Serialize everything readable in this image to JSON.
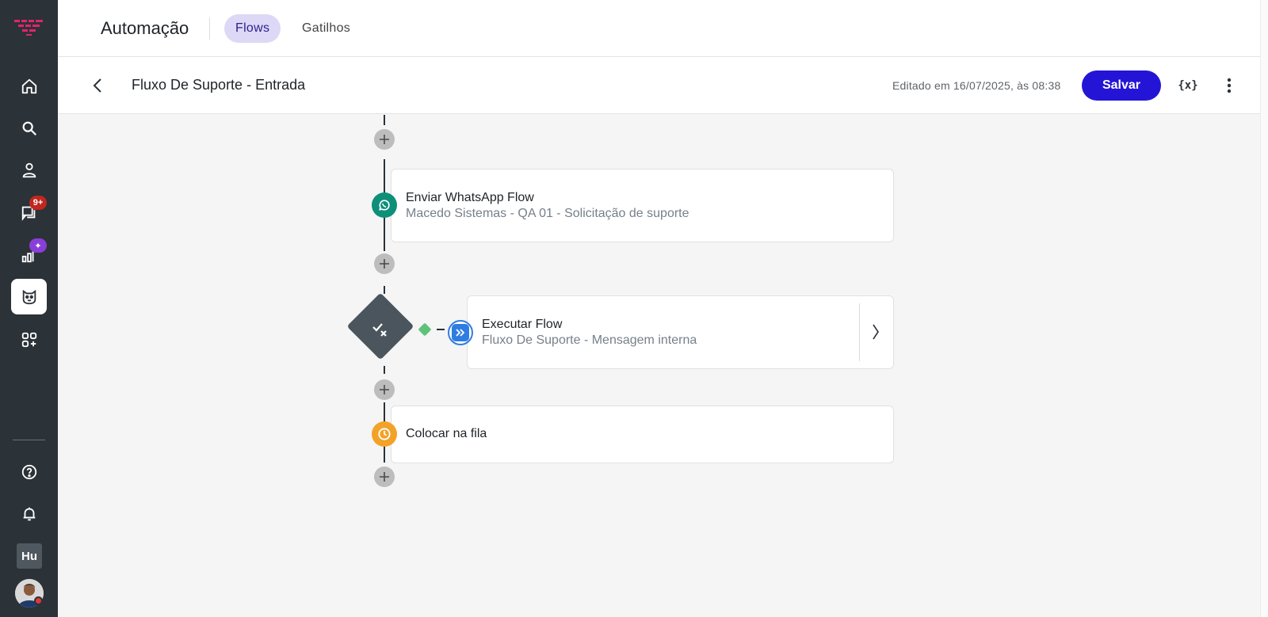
{
  "sidebar": {
    "items": [
      {
        "name": "home",
        "icon": "home-icon"
      },
      {
        "name": "search",
        "icon": "search-icon"
      },
      {
        "name": "contacts",
        "icon": "person-icon"
      },
      {
        "name": "chats",
        "icon": "chat-icon",
        "badge": "9+"
      },
      {
        "name": "reports",
        "icon": "bar-chart-icon",
        "badge": "✦"
      },
      {
        "name": "automation",
        "icon": "bot-icon",
        "active": true
      },
      {
        "name": "apps",
        "icon": "apps-add-icon"
      },
      {
        "name": "help",
        "icon": "help-icon"
      },
      {
        "name": "notifications",
        "icon": "bell-icon"
      }
    ],
    "workspace_initials": "Hu",
    "brand_color": "#e0246e"
  },
  "topnav": {
    "title": "Automação",
    "tabs": [
      {
        "label": "Flows",
        "active": true
      },
      {
        "label": "Gatilhos",
        "active": false
      }
    ]
  },
  "header": {
    "flow_name": "Fluxo De Suporte - Entrada",
    "edited_text": "Editado em 16/07/2025, às 08:38",
    "save_label": "Salvar",
    "vars_label": "{x}",
    "accent_color": "#2415d6"
  },
  "canvas": {
    "nodes": [
      {
        "type": "whatsapp",
        "title": "Enviar WhatsApp Flow",
        "subtitle": "Macedo Sistemas - QA 01 - Solicitação de suporte",
        "icon": "whatsapp-icon",
        "color": "#0e8f7a"
      },
      {
        "type": "condition",
        "icon": "check-x-icon"
      },
      {
        "type": "execute-flow",
        "title": "Executar Flow",
        "subtitle": "Fluxo De Suporte - Mensagem interna",
        "icon": "double-chevron-icon",
        "color": "#2f7de1"
      },
      {
        "type": "queue",
        "title": "Colocar na fila",
        "icon": "clock-icon",
        "color": "#f3a228"
      }
    ]
  }
}
